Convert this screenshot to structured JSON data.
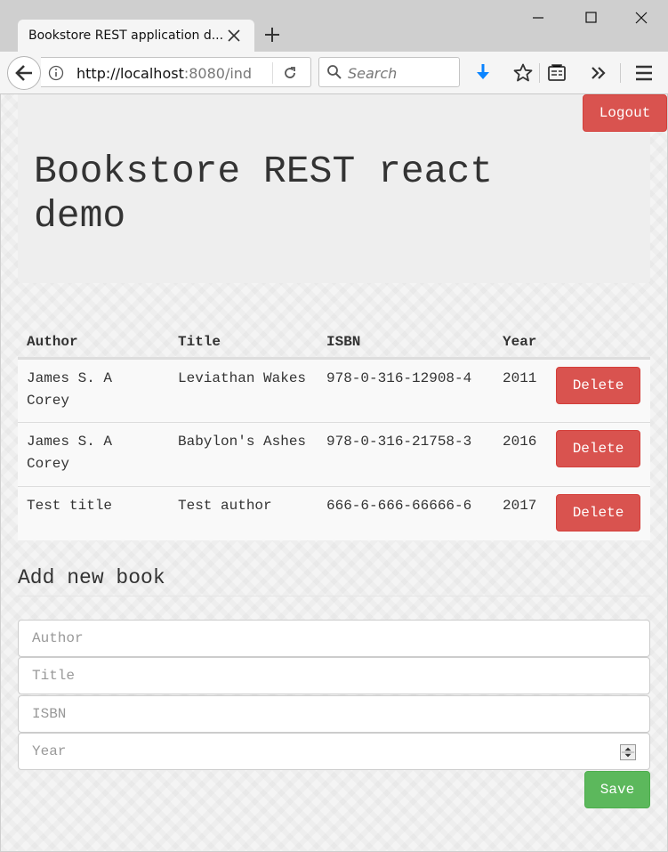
{
  "browser": {
    "tab_title": "Bookstore REST application d...",
    "url_host": "http://localhost",
    "url_rest": ":8080/ind",
    "search_placeholder": "Search"
  },
  "header": {
    "title": "Bookstore REST react demo",
    "logout_label": "Logout"
  },
  "table": {
    "columns": [
      "Author",
      "Title",
      "ISBN",
      "Year"
    ],
    "delete_label": "Delete",
    "rows": [
      {
        "author": "James S. A Corey",
        "title": "Leviathan Wakes",
        "isbn": "978-0-316-12908-4",
        "year": "2011"
      },
      {
        "author": "James S. A Corey",
        "title": "Babylon's Ashes",
        "isbn": "978-0-316-21758-3",
        "year": "2016"
      },
      {
        "author": "Test title",
        "title": "Test author",
        "isbn": "666-6-666-66666-6",
        "year": "2017"
      }
    ]
  },
  "form": {
    "heading": "Add new book",
    "author_placeholder": "Author",
    "title_placeholder": "Title",
    "isbn_placeholder": "ISBN",
    "year_placeholder": "Year",
    "save_label": "Save"
  },
  "colors": {
    "danger": "#d9534f",
    "success": "#5cb85c",
    "jumbotron": "#eeeeee"
  }
}
